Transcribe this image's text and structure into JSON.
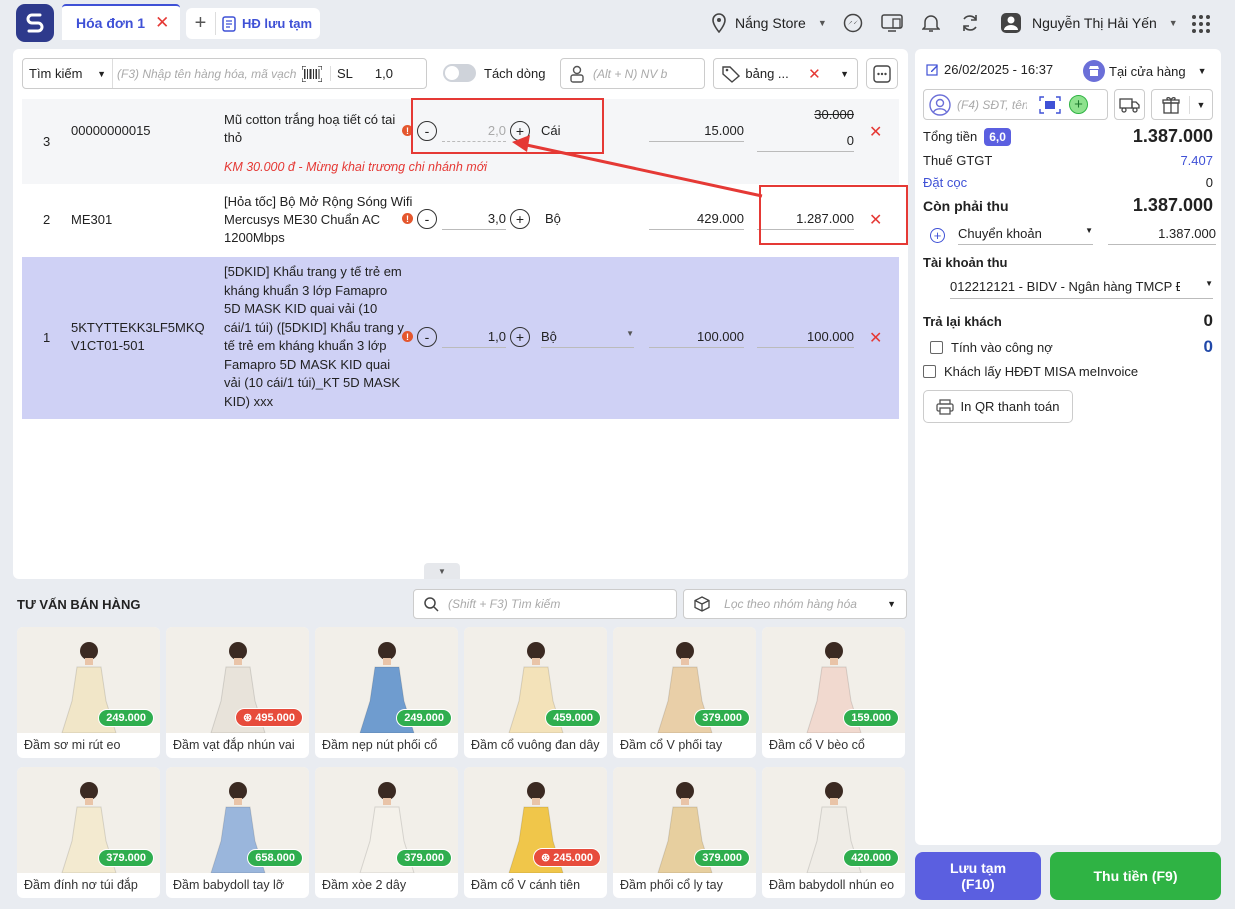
{
  "tabs": {
    "active": "Hóa đơn 1",
    "saved": "HĐ lưu tạm"
  },
  "header": {
    "store": "Nắng Store",
    "user": "Nguyễn Thị Hải Yến"
  },
  "toolbar": {
    "search_mode": "Tìm kiếm",
    "search_placeholder": "(F3) Nhập tên hàng hóa, mã vạch",
    "qty_label": "SL",
    "qty_value": "1,0",
    "split_label": "Tách dòng",
    "staff_placeholder": "(Alt + N) NV b",
    "pricebook": "bảng ..."
  },
  "items": [
    {
      "no": "3",
      "code": "00000000015",
      "name": "Mũ cotton trắng hoạ tiết có tai thỏ",
      "qty": "2,0",
      "unit": "Cái",
      "price": "15.000",
      "old_total": "30.000",
      "total": "0",
      "promo": "KM 30.000 đ - Mừng khai trương chi nhánh mới"
    },
    {
      "no": "2",
      "code": "ME301",
      "name": "[Hỏa tốc] Bộ Mở Rộng Sóng Wifi Mercusys ME30 Chuẩn AC 1200Mbps",
      "qty": "3,0",
      "unit": "Bộ",
      "price": "429.000",
      "total": "1.287.000"
    },
    {
      "no": "1",
      "code": "5KTYTTEKK3LF5MKQV1CT01-501",
      "name": "[5DKID] Khẩu trang y tế trẻ em kháng khuẩn 3 lớp Famapro 5D MASK KID quai vải (10 cái/1 túi) ([5DKID] Khẩu trang y tế trẻ em kháng khuẩn 3 lớp Famapro 5D MASK KID quai vải (10 cái/1 túi)_KT 5D MASK KID) xxx",
      "qty": "1,0",
      "unit": "Bộ",
      "price": "100.000",
      "total": "100.000"
    }
  ],
  "order": {
    "datetime": "26/02/2025 - 16:37",
    "channel": "Tại cửa hàng",
    "customer_placeholder": "(F4) SĐT, tên",
    "total_label": "Tổng tiền",
    "total_qty": "6,0",
    "total": "1.387.000",
    "vat_label": "Thuế GTGT",
    "vat": "7.407",
    "deposit_label": "Đặt cọc",
    "deposit": "0",
    "due_label": "Còn phải thu",
    "due": "1.387.000",
    "pay_method": "Chuyển khoản",
    "pay_amount": "1.387.000",
    "account_label": "Tài khoản thu",
    "account": "012212121 - BIDV - Ngân hàng TMCP Đ",
    "change_label": "Trả lại khách",
    "change": "0",
    "debt_label": "Tính vào công nợ",
    "debt": "0",
    "einvoice_label": "Khách lấy HĐĐT MISA meInvoice",
    "print_qr": "In QR thanh toán"
  },
  "suggest": {
    "title": "TƯ VẤN BÁN HÀNG",
    "search_placeholder": "(Shift + F3) Tìm kiếm",
    "group_placeholder": "Lọc theo nhóm hàng hóa"
  },
  "products": [
    {
      "name": "Đầm sơ mi rút eo",
      "price": "249.000",
      "sale": false,
      "color": "#f1e6c8"
    },
    {
      "name": "Đầm vạt đắp nhún vai",
      "price": "495.000",
      "sale": true,
      "color": "#e8e3da"
    },
    {
      "name": "Đầm nẹp nút phối cổ",
      "price": "249.000",
      "sale": false,
      "color": "#6f9ccf"
    },
    {
      "name": "Đầm cổ vuông đan dây",
      "price": "459.000",
      "sale": false,
      "color": "#f3e2b9"
    },
    {
      "name": "Đầm cổ V phối tay",
      "price": "379.000",
      "sale": false,
      "color": "#e9cfa8"
    },
    {
      "name": "Đầm cổ V bèo cổ",
      "price": "159.000",
      "sale": false,
      "color": "#f1d9cf"
    },
    {
      "name": "Đầm đính nơ túi đắp",
      "price": "379.000",
      "sale": false,
      "color": "#f3ead0"
    },
    {
      "name": "Đầm babydoll tay lỡ",
      "price": "658.000",
      "sale": false,
      "color": "#9ab6dc"
    },
    {
      "name": "Đầm xòe 2 dây",
      "price": "379.000",
      "sale": false,
      "color": "#f4f1ea"
    },
    {
      "name": "Đầm cổ V cánh tiên",
      "price": "245.000",
      "sale": true,
      "color": "#f0c64a"
    },
    {
      "name": "Đầm phối cổ ly tay",
      "price": "379.000",
      "sale": false,
      "color": "#e7cf9f"
    },
    {
      "name": "Đầm babydoll nhún eo",
      "price": "420.000",
      "sale": false,
      "color": "#efece6"
    }
  ],
  "actions": {
    "save": "Lưu tạm",
    "save_key": "(F10)",
    "pay": "Thu tiền (F9)"
  },
  "colors": {
    "primary": "#3f51d6",
    "danger": "#e53935",
    "success": "#2fb344",
    "selected_row": "#cfd1f5"
  }
}
